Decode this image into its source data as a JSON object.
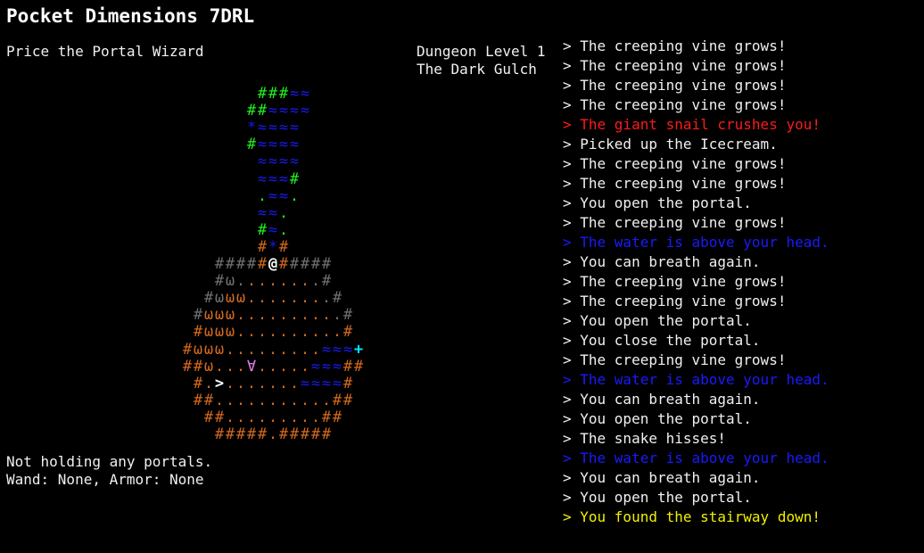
{
  "app": {
    "title": "Pocket Dimensions 7DRL"
  },
  "player": {
    "name": "Price the Portal Wizard"
  },
  "dungeon": {
    "level_label": "Dungeon Level 1",
    "name": "The Dark Gulch"
  },
  "status": {
    "portals": "Not holding any portals.",
    "equipment": "Wand: None, Armor: None"
  },
  "colors": {
    "text": "#f0f0f0",
    "wall_lit": "#d2691e",
    "wall_dim": "#707070",
    "vine": "#22ee22",
    "water": "#1a1ae6",
    "portal": "#00e5ff",
    "player": "#ffffff",
    "stairs": "#ffffff",
    "snail": "#e07ce8",
    "log_danger": "#ff1a1a",
    "log_water": "#1a1aff",
    "log_success": "#f0f000"
  },
  "map": {
    "legend": {
      "#": "wall",
      ".": "floor",
      "≈": "water",
      "ω": "creeping-vine-or-grass",
      "@": "player",
      ">": "stairs-down",
      "+": "portal",
      "∀": "giant-snail",
      "*": "item"
    },
    "rows": [
      {
        "col": 24,
        "cells": [
          [
            "#",
            "vine"
          ],
          [
            "#",
            "vine"
          ],
          [
            "#",
            "vine"
          ],
          [
            "≈",
            "water"
          ],
          [
            "≈",
            "water"
          ]
        ]
      },
      {
        "col": 23,
        "cells": [
          [
            "#",
            "vine"
          ],
          [
            "#",
            "vine"
          ],
          [
            "≈",
            "water"
          ],
          [
            "≈",
            "water"
          ],
          [
            "≈",
            "water"
          ],
          [
            "≈",
            "water"
          ]
        ]
      },
      {
        "col": 23,
        "cells": [
          [
            "*",
            "water"
          ],
          [
            "≈",
            "water"
          ],
          [
            "≈",
            "water"
          ],
          [
            "≈",
            "water"
          ],
          [
            "≈",
            "water"
          ]
        ]
      },
      {
        "col": 23,
        "cells": [
          [
            "#",
            "vine"
          ],
          [
            "≈",
            "water"
          ],
          [
            "≈",
            "water"
          ],
          [
            "≈",
            "water"
          ],
          [
            "≈",
            "water"
          ]
        ]
      },
      {
        "col": 24,
        "cells": [
          [
            "≈",
            "water"
          ],
          [
            "≈",
            "water"
          ],
          [
            "≈",
            "water"
          ],
          [
            "≈",
            "water"
          ]
        ]
      },
      {
        "col": 24,
        "cells": [
          [
            "≈",
            "water"
          ],
          [
            "≈",
            "water"
          ],
          [
            "≈",
            "water"
          ],
          [
            "#",
            "vine"
          ]
        ]
      },
      {
        "col": 24,
        "cells": [
          [
            ".",
            "vine"
          ],
          [
            "≈",
            "water"
          ],
          [
            "≈",
            "water"
          ],
          [
            ".",
            "vine"
          ]
        ]
      },
      {
        "col": 24,
        "cells": [
          [
            "≈",
            "water"
          ],
          [
            "≈",
            "water"
          ],
          [
            ".",
            "vine"
          ]
        ]
      },
      {
        "col": 24,
        "cells": [
          [
            "#",
            "vine"
          ],
          [
            "≈",
            "water"
          ],
          [
            ".",
            "vine"
          ]
        ]
      },
      {
        "col": 24,
        "cells": [
          [
            "#",
            "wall_lit"
          ],
          [
            "*",
            "water"
          ],
          [
            "#",
            "wall_lit"
          ]
        ]
      },
      {
        "col": 20,
        "cells": [
          [
            "#",
            "wall_dim"
          ],
          [
            "#",
            "wall_dim"
          ],
          [
            "#",
            "wall_dim"
          ],
          [
            "#",
            "wall_dim"
          ],
          [
            "#",
            "wall_lit"
          ],
          [
            "@",
            "player"
          ],
          [
            "#",
            "wall_lit"
          ],
          [
            "#",
            "wall_dim"
          ],
          [
            "#",
            "wall_dim"
          ],
          [
            "#",
            "wall_dim"
          ],
          [
            "#",
            "wall_dim"
          ]
        ]
      },
      {
        "col": 20,
        "cells": [
          [
            "#",
            "wall_dim"
          ],
          [
            "ω",
            "wall_dim"
          ],
          [
            ".",
            "wall_dim"
          ],
          [
            ".",
            "wall_lit"
          ],
          [
            ".",
            "wall_lit"
          ],
          [
            ".",
            "wall_lit"
          ],
          [
            ".",
            "wall_lit"
          ],
          [
            ".",
            "wall_lit"
          ],
          [
            ".",
            "wall_lit"
          ],
          [
            ".",
            "wall_dim"
          ],
          [
            "#",
            "wall_dim"
          ]
        ]
      },
      {
        "col": 19,
        "cells": [
          [
            "#",
            "wall_dim"
          ],
          [
            "ω",
            "wall_dim"
          ],
          [
            "ω",
            "wall_lit"
          ],
          [
            "ω",
            "wall_lit"
          ],
          [
            ".",
            "wall_lit"
          ],
          [
            ".",
            "wall_lit"
          ],
          [
            ".",
            "wall_lit"
          ],
          [
            ".",
            "wall_lit"
          ],
          [
            ".",
            "wall_lit"
          ],
          [
            ".",
            "wall_lit"
          ],
          [
            ".",
            "wall_lit"
          ],
          [
            ".",
            "wall_dim"
          ],
          [
            "#",
            "wall_dim"
          ]
        ]
      },
      {
        "col": 18,
        "cells": [
          [
            "#",
            "wall_dim"
          ],
          [
            "ω",
            "wall_lit"
          ],
          [
            "ω",
            "wall_lit"
          ],
          [
            "ω",
            "wall_lit"
          ],
          [
            ".",
            "wall_lit"
          ],
          [
            ".",
            "wall_lit"
          ],
          [
            ".",
            "wall_lit"
          ],
          [
            ".",
            "wall_lit"
          ],
          [
            ".",
            "wall_lit"
          ],
          [
            ".",
            "wall_lit"
          ],
          [
            ".",
            "wall_lit"
          ],
          [
            ".",
            "wall_lit"
          ],
          [
            ".",
            "wall_lit"
          ],
          [
            ".",
            "wall_dim"
          ],
          [
            "#",
            "wall_dim"
          ]
        ]
      },
      {
        "col": 18,
        "cells": [
          [
            "#",
            "wall_lit"
          ],
          [
            "ω",
            "wall_lit"
          ],
          [
            "ω",
            "wall_lit"
          ],
          [
            "ω",
            "wall_lit"
          ],
          [
            ".",
            "wall_lit"
          ],
          [
            ".",
            "wall_lit"
          ],
          [
            ".",
            "wall_lit"
          ],
          [
            ".",
            "wall_lit"
          ],
          [
            ".",
            "wall_lit"
          ],
          [
            ".",
            "wall_lit"
          ],
          [
            ".",
            "wall_lit"
          ],
          [
            ".",
            "wall_lit"
          ],
          [
            ".",
            "wall_lit"
          ],
          [
            ".",
            "wall_lit"
          ],
          [
            "#",
            "wall_lit"
          ]
        ]
      },
      {
        "col": 17,
        "cells": [
          [
            "#",
            "wall_lit"
          ],
          [
            "ω",
            "wall_lit"
          ],
          [
            "ω",
            "wall_lit"
          ],
          [
            "ω",
            "wall_lit"
          ],
          [
            ".",
            "wall_lit"
          ],
          [
            ".",
            "wall_lit"
          ],
          [
            ".",
            "wall_lit"
          ],
          [
            ".",
            "wall_lit"
          ],
          [
            ".",
            "wall_lit"
          ],
          [
            ".",
            "wall_lit"
          ],
          [
            ".",
            "wall_lit"
          ],
          [
            ".",
            "wall_lit"
          ],
          [
            ".",
            "wall_lit"
          ],
          [
            "≈",
            "water"
          ],
          [
            "≈",
            "water"
          ],
          [
            "≈",
            "water"
          ],
          [
            "+",
            "portal"
          ]
        ]
      },
      {
        "col": 17,
        "cells": [
          [
            "#",
            "wall_lit"
          ],
          [
            "#",
            "wall_lit"
          ],
          [
            "ω",
            "wall_lit"
          ],
          [
            ".",
            "wall_lit"
          ],
          [
            ".",
            "wall_lit"
          ],
          [
            ".",
            "wall_lit"
          ],
          [
            "∀",
            "snail"
          ],
          [
            ".",
            "wall_lit"
          ],
          [
            ".",
            "wall_lit"
          ],
          [
            ".",
            "wall_lit"
          ],
          [
            ".",
            "wall_lit"
          ],
          [
            ".",
            "wall_lit"
          ],
          [
            "≈",
            "water"
          ],
          [
            "≈",
            "water"
          ],
          [
            "≈",
            "water"
          ],
          [
            "#",
            "wall_lit"
          ],
          [
            "#",
            "wall_lit"
          ]
        ]
      },
      {
        "col": 18,
        "cells": [
          [
            "#",
            "wall_lit"
          ],
          [
            ".",
            "wall_lit"
          ],
          [
            ">",
            "stairs"
          ],
          [
            ".",
            "wall_lit"
          ],
          [
            ".",
            "wall_lit"
          ],
          [
            ".",
            "wall_lit"
          ],
          [
            ".",
            "wall_lit"
          ],
          [
            ".",
            "wall_lit"
          ],
          [
            ".",
            "wall_lit"
          ],
          [
            ".",
            "wall_lit"
          ],
          [
            "≈",
            "water"
          ],
          [
            "≈",
            "water"
          ],
          [
            "≈",
            "water"
          ],
          [
            "≈",
            "water"
          ],
          [
            "#",
            "wall_lit"
          ]
        ]
      },
      {
        "col": 18,
        "cells": [
          [
            "#",
            "wall_lit"
          ],
          [
            "#",
            "wall_lit"
          ],
          [
            ".",
            "wall_lit"
          ],
          [
            ".",
            "wall_lit"
          ],
          [
            ".",
            "wall_lit"
          ],
          [
            ".",
            "wall_lit"
          ],
          [
            ".",
            "wall_lit"
          ],
          [
            ".",
            "wall_lit"
          ],
          [
            ".",
            "wall_lit"
          ],
          [
            ".",
            "wall_lit"
          ],
          [
            ".",
            "wall_lit"
          ],
          [
            ".",
            "wall_lit"
          ],
          [
            ".",
            "wall_lit"
          ],
          [
            "#",
            "wall_lit"
          ],
          [
            "#",
            "wall_lit"
          ]
        ]
      },
      {
        "col": 19,
        "cells": [
          [
            "#",
            "wall_lit"
          ],
          [
            "#",
            "wall_lit"
          ],
          [
            ".",
            "wall_lit"
          ],
          [
            ".",
            "wall_lit"
          ],
          [
            ".",
            "wall_lit"
          ],
          [
            ".",
            "wall_lit"
          ],
          [
            ".",
            "wall_lit"
          ],
          [
            ".",
            "wall_lit"
          ],
          [
            ".",
            "wall_lit"
          ],
          [
            ".",
            "wall_lit"
          ],
          [
            ".",
            "wall_lit"
          ],
          [
            "#",
            "wall_lit"
          ],
          [
            "#",
            "wall_lit"
          ]
        ]
      },
      {
        "col": 20,
        "cells": [
          [
            "#",
            "wall_lit"
          ],
          [
            "#",
            "wall_lit"
          ],
          [
            "#",
            "wall_lit"
          ],
          [
            "#",
            "wall_lit"
          ],
          [
            "#",
            "wall_lit"
          ],
          [
            ".",
            "wall_lit"
          ],
          [
            "#",
            "wall_lit"
          ],
          [
            "#",
            "wall_lit"
          ],
          [
            "#",
            "wall_lit"
          ],
          [
            "#",
            "wall_lit"
          ],
          [
            "#",
            "wall_lit"
          ]
        ]
      }
    ]
  },
  "log": {
    "prefix": "> ",
    "messages": [
      {
        "text": "The creeping vine grows!",
        "kind": "text"
      },
      {
        "text": "The creeping vine grows!",
        "kind": "text"
      },
      {
        "text": "The creeping vine grows!",
        "kind": "text"
      },
      {
        "text": "The creeping vine grows!",
        "kind": "text"
      },
      {
        "text": "The giant snail crushes you!",
        "kind": "log_danger"
      },
      {
        "text": "Picked up the Icecream.",
        "kind": "text"
      },
      {
        "text": "The creeping vine grows!",
        "kind": "text"
      },
      {
        "text": "The creeping vine grows!",
        "kind": "text"
      },
      {
        "text": "You open the portal.",
        "kind": "text"
      },
      {
        "text": "The creeping vine grows!",
        "kind": "text"
      },
      {
        "text": "The water is above your head.",
        "kind": "log_water"
      },
      {
        "text": "You can breath again.",
        "kind": "text"
      },
      {
        "text": "The creeping vine grows!",
        "kind": "text"
      },
      {
        "text": "The creeping vine grows!",
        "kind": "text"
      },
      {
        "text": "You open the portal.",
        "kind": "text"
      },
      {
        "text": "You close the portal.",
        "kind": "text"
      },
      {
        "text": "The creeping vine grows!",
        "kind": "text"
      },
      {
        "text": "The water is above your head.",
        "kind": "log_water"
      },
      {
        "text": "You can breath again.",
        "kind": "text"
      },
      {
        "text": "You open the portal.",
        "kind": "text"
      },
      {
        "text": "The snake hisses!",
        "kind": "text"
      },
      {
        "text": "The water is above your head.",
        "kind": "log_water"
      },
      {
        "text": "You can breath again.",
        "kind": "text"
      },
      {
        "text": "You open the portal.",
        "kind": "text"
      },
      {
        "text": "You found the stairway down!",
        "kind": "log_success"
      }
    ]
  }
}
